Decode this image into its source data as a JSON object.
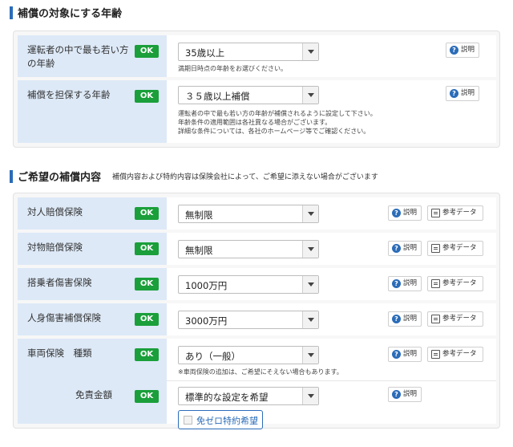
{
  "age_section": {
    "title": "補償の対象にする年齢",
    "rows": [
      {
        "label": "運転者の中で最も若い方の年齢",
        "status": "OK",
        "select_value": "35歳以上",
        "help": [
          "満期日時点の年齢をお選びください。"
        ],
        "explain_label": "説明"
      },
      {
        "label": "補償を担保する年齢",
        "status": "OK",
        "select_value": "３５歳以上補償",
        "help": [
          "運転者の中で最も若い方の年齢が補償されるように設定して下さい。",
          "年齢条件の適用範囲は各社異なる場合がございます。",
          "詳細な条件については、各社のホームページ等でご確認ください。"
        ],
        "explain_label": "説明"
      }
    ]
  },
  "coverage_section": {
    "title": "ご希望の補償内容",
    "note": "補償内容および特約内容は保険会社によって、ご希望に添えない場合がございます",
    "rows": [
      {
        "label": "対人賠償保険",
        "status": "OK",
        "select_value": "無制限",
        "explain_label": "説明",
        "ref_label": "参考データ"
      },
      {
        "label": "対物賠償保険",
        "status": "OK",
        "select_value": "無制限",
        "explain_label": "説明",
        "ref_label": "参考データ"
      },
      {
        "label": "搭乗者傷害保険",
        "status": "OK",
        "select_value": "1000万円",
        "explain_label": "説明",
        "ref_label": "参考データ"
      },
      {
        "label": "人身傷害補償保険",
        "status": "OK",
        "select_value": "3000万円",
        "explain_label": "説明",
        "ref_label": "参考データ"
      }
    ],
    "vehicle": {
      "label": "車両保険　種類",
      "status": "OK",
      "select_value": "あり（一般）",
      "help": "※車両保険の追加は、ご希望にそえない場合もあります。",
      "explain_label": "説明",
      "ref_label": "参考データ",
      "deductible_label": "免責金額",
      "deductible_status": "OK",
      "deductible_value": "標準的な設定を希望",
      "deductible_explain_label": "説明",
      "zero_rider_label": "免ゼロ特約希望"
    }
  }
}
